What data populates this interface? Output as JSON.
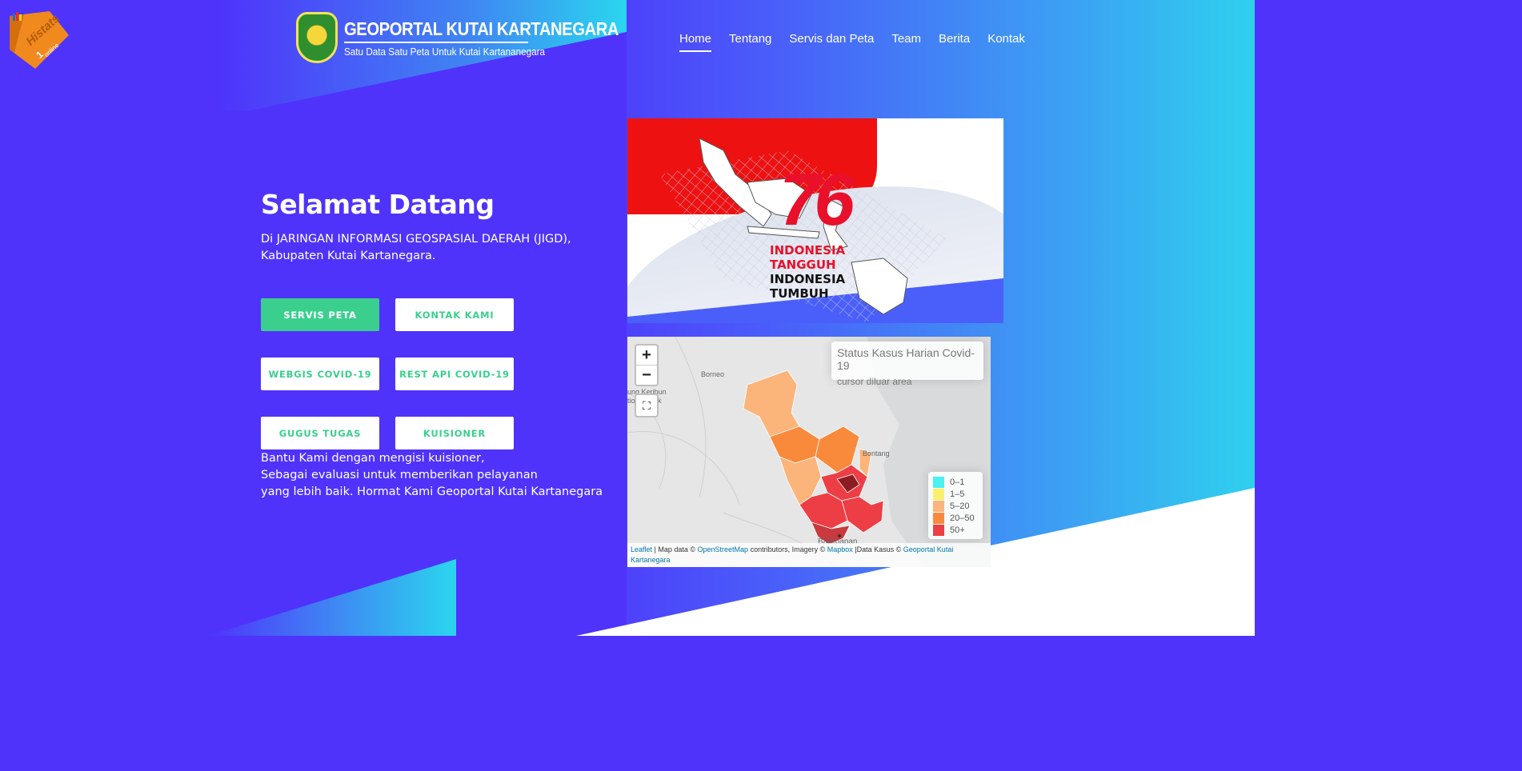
{
  "histats": {
    "brand": "Histats",
    "online_count": "1",
    "online_label": "online"
  },
  "logo": {
    "title": "GEOPORTAL KUTAI KARTANEGARA",
    "tagline": "Satu Data Satu Peta Untuk Kutai Kartananegara"
  },
  "nav": {
    "items": [
      "Home",
      "Tentang",
      "Servis dan Peta",
      "Team",
      "Berita",
      "Kontak"
    ],
    "active": "Home"
  },
  "hero": {
    "title": "Selamat Datang",
    "line1": "Di JARINGAN INFORMASI GEOSPASIAL DAERAH (JIGD),",
    "line2": "Kabupaten Kutai Kartanegara."
  },
  "buttons": {
    "servis_peta": "SERVIS PETA",
    "kontak_kami": "KONTAK KAMI",
    "webgis": "WEBGIS COVID-19",
    "rest_api": "REST API COVID-19",
    "gugus_tugas": "GUGUS TUGAS",
    "kuisioner": "KUISIONER"
  },
  "note": {
    "line1": "Bantu Kami dengan mengisi kuisioner,",
    "line2": "Sebagai evaluasi untuk memberikan pelayanan",
    "line3": "yang lebih baik. Hormat Kami Geoportal Kutai Kartanegara"
  },
  "banner": {
    "number": "76",
    "line1": "INDONESIA",
    "line2": "TANGGUH",
    "line3": "INDONESIA",
    "line4": "TUMBUH"
  },
  "map": {
    "zoom_in": "+",
    "zoom_out": "−",
    "info_title": "Status Kasus Harian Covid-19",
    "info_sub": "cursor diluar area",
    "labels": {
      "borneo": "Borneo",
      "bontang": "Bontang",
      "balikpapan": "Balikpapan",
      "kerihun": "ung Kerihun",
      "park": "tional Park"
    },
    "legend": [
      {
        "label": "0–1",
        "color": "#49f1f3"
      },
      {
        "label": "1–5",
        "color": "#fdf06a"
      },
      {
        "label": "5–20",
        "color": "#fbb47a"
      },
      {
        "label": "20–50",
        "color": "#f98a3b"
      },
      {
        "label": "50+",
        "color": "#ed3e45"
      }
    ],
    "attribution": {
      "leaflet": "Leaflet",
      "t1": " | Map data © ",
      "osm": "OpenStreetMap",
      "t2": " contributors, Imagery © ",
      "mapbox": "Mapbox",
      "t3": " |Data Kasus © ",
      "geoportal": "Geoportal Kutai Kartanegara"
    }
  }
}
